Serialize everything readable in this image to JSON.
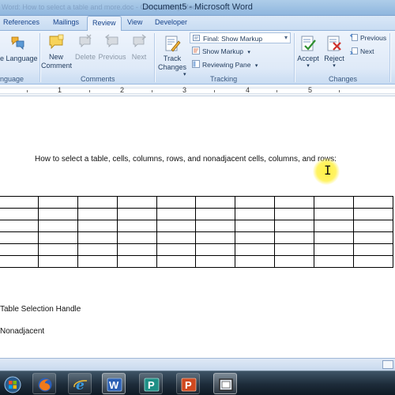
{
  "window": {
    "title": "Document5 - Microsoft Word",
    "ghost_text": "Word: How to select a table and more.doc - Compatibility Mode"
  },
  "tabs": [
    {
      "label": "References",
      "active": false
    },
    {
      "label": "Mailings",
      "active": false
    },
    {
      "label": "Review",
      "active": true
    },
    {
      "label": "View",
      "active": false
    },
    {
      "label": "Developer",
      "active": false
    }
  ],
  "ribbon": {
    "proofing": {
      "language_label": "e Language",
      "group_label": "nguage"
    },
    "comments": {
      "group_label": "Comments",
      "new_comment": "New\nComment",
      "delete": "Delete",
      "previous": "Previous",
      "next": "Next"
    },
    "tracking": {
      "group_label": "Tracking",
      "track_changes": "Track\nChanges",
      "display_for_review": "Final: Show Markup",
      "show_markup": "Show Markup",
      "reviewing_pane": "Reviewing Pane"
    },
    "changes": {
      "group_label": "Changes",
      "accept": "Accept",
      "reject": "Reject",
      "previous": "Previous",
      "next": "Next"
    }
  },
  "ruler": {
    "numbers": [
      "1",
      "2",
      "3",
      "4",
      "5"
    ]
  },
  "document": {
    "heading": "How to select a table, cells, columns, rows, and nonadjacent cells, columns, and rows:",
    "table": {
      "rows": 6,
      "cols": 10
    },
    "label1": "Table Selection Handle",
    "label2": "Nonadjacent"
  },
  "taskbar": {
    "items": [
      {
        "name": "start-orb",
        "state": "none"
      },
      {
        "name": "firefox",
        "state": "pinned"
      },
      {
        "name": "internet-explorer",
        "state": "pinned"
      },
      {
        "name": "word",
        "state": "active"
      },
      {
        "name": "publisher",
        "state": "pinned"
      },
      {
        "name": "powerpoint",
        "state": "pinned"
      },
      {
        "name": "screen-recorder",
        "state": "active"
      }
    ]
  },
  "colors": {
    "accent": "#15428b",
    "ribbon_bg": "#dfeaf8",
    "highlight_cursor": "#fff03c"
  }
}
